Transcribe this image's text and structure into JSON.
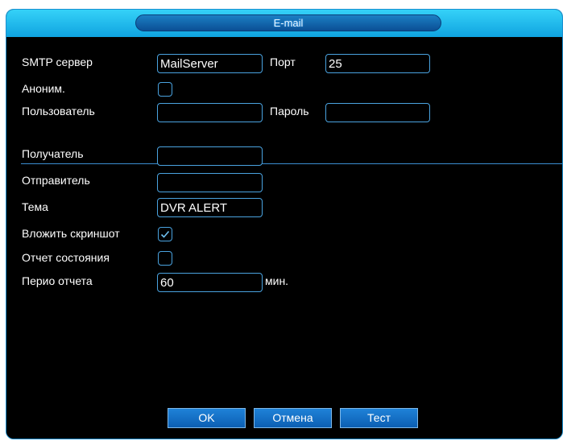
{
  "window": {
    "title": "E-mail"
  },
  "smtp": {
    "server_label": "SMTP сервер",
    "server_value": "MailServer",
    "port_label": "Порт",
    "port_value": "25",
    "anonymous_label": "Аноним.",
    "anonymous_checked": false,
    "user_label": "Пользователь",
    "user_value": "",
    "password_label": "Пароль",
    "password_value": ""
  },
  "mail": {
    "recipient_label": "Получатель",
    "recipient_value": "",
    "sender_label": "Отправитель",
    "sender_value": "",
    "subject_label": "Тема",
    "subject_value": "DVR ALERT",
    "attach_label": "Вложить скриншот",
    "attach_checked": true,
    "status_label": "Отчет состояния",
    "status_checked": false,
    "period_label": "Перио отчета",
    "period_value": "60",
    "period_unit": "мин."
  },
  "buttons": {
    "ok": "OK",
    "cancel": "Отмена",
    "test": "Тест"
  },
  "colors": {
    "accent": "#4aa3e0",
    "titlebar": "#1fb6f0",
    "background": "#000000"
  }
}
